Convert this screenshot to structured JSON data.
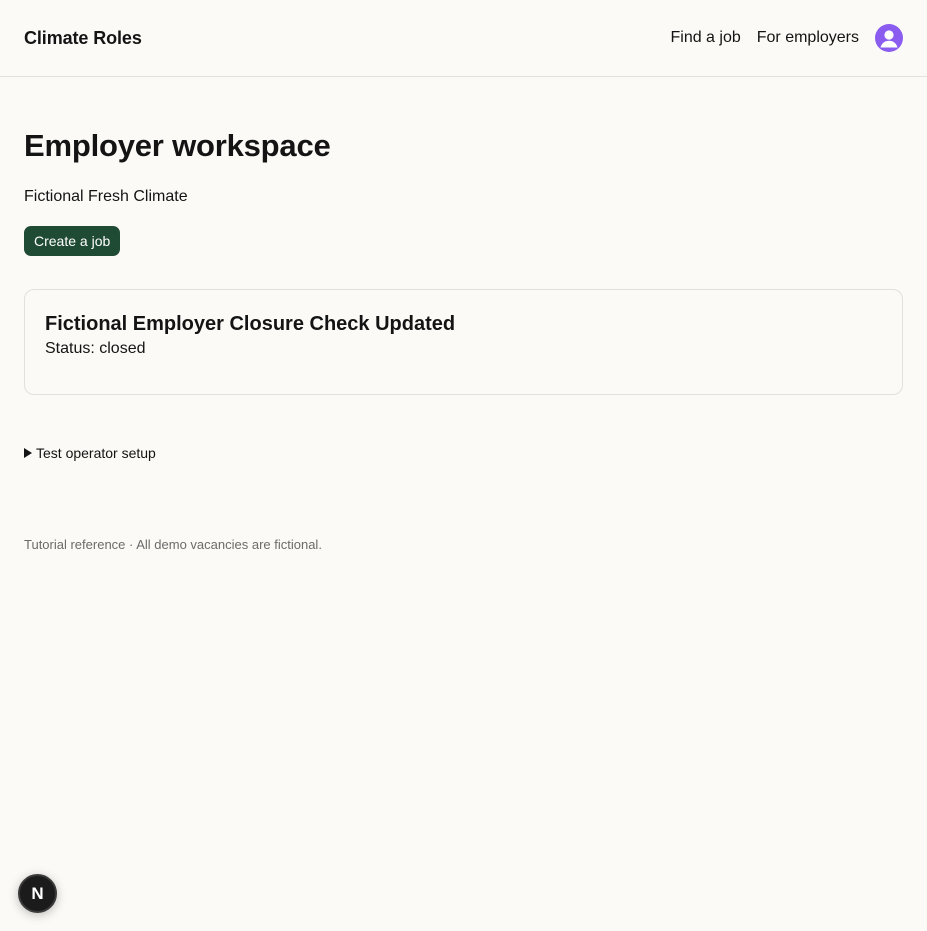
{
  "header": {
    "brand": "Climate Roles",
    "nav": [
      {
        "label": "Find a job"
      },
      {
        "label": "For employers"
      }
    ],
    "avatar_color": "#8a5cf0"
  },
  "main": {
    "title": "Employer workspace",
    "company": "Fictional Fresh Climate",
    "create_button_label": "Create a job",
    "jobs": [
      {
        "title": "Fictional Employer Closure Check Updated",
        "status": "Status: closed"
      }
    ],
    "details_label": "Test operator setup",
    "footer_note": "Tutorial reference · All demo vacancies are fictional."
  },
  "dev_badge": {
    "letter": "N"
  },
  "colors": {
    "background": "#fbfaf6",
    "primary_button": "#1f4a33",
    "muted_text": "#6b6b6b"
  }
}
